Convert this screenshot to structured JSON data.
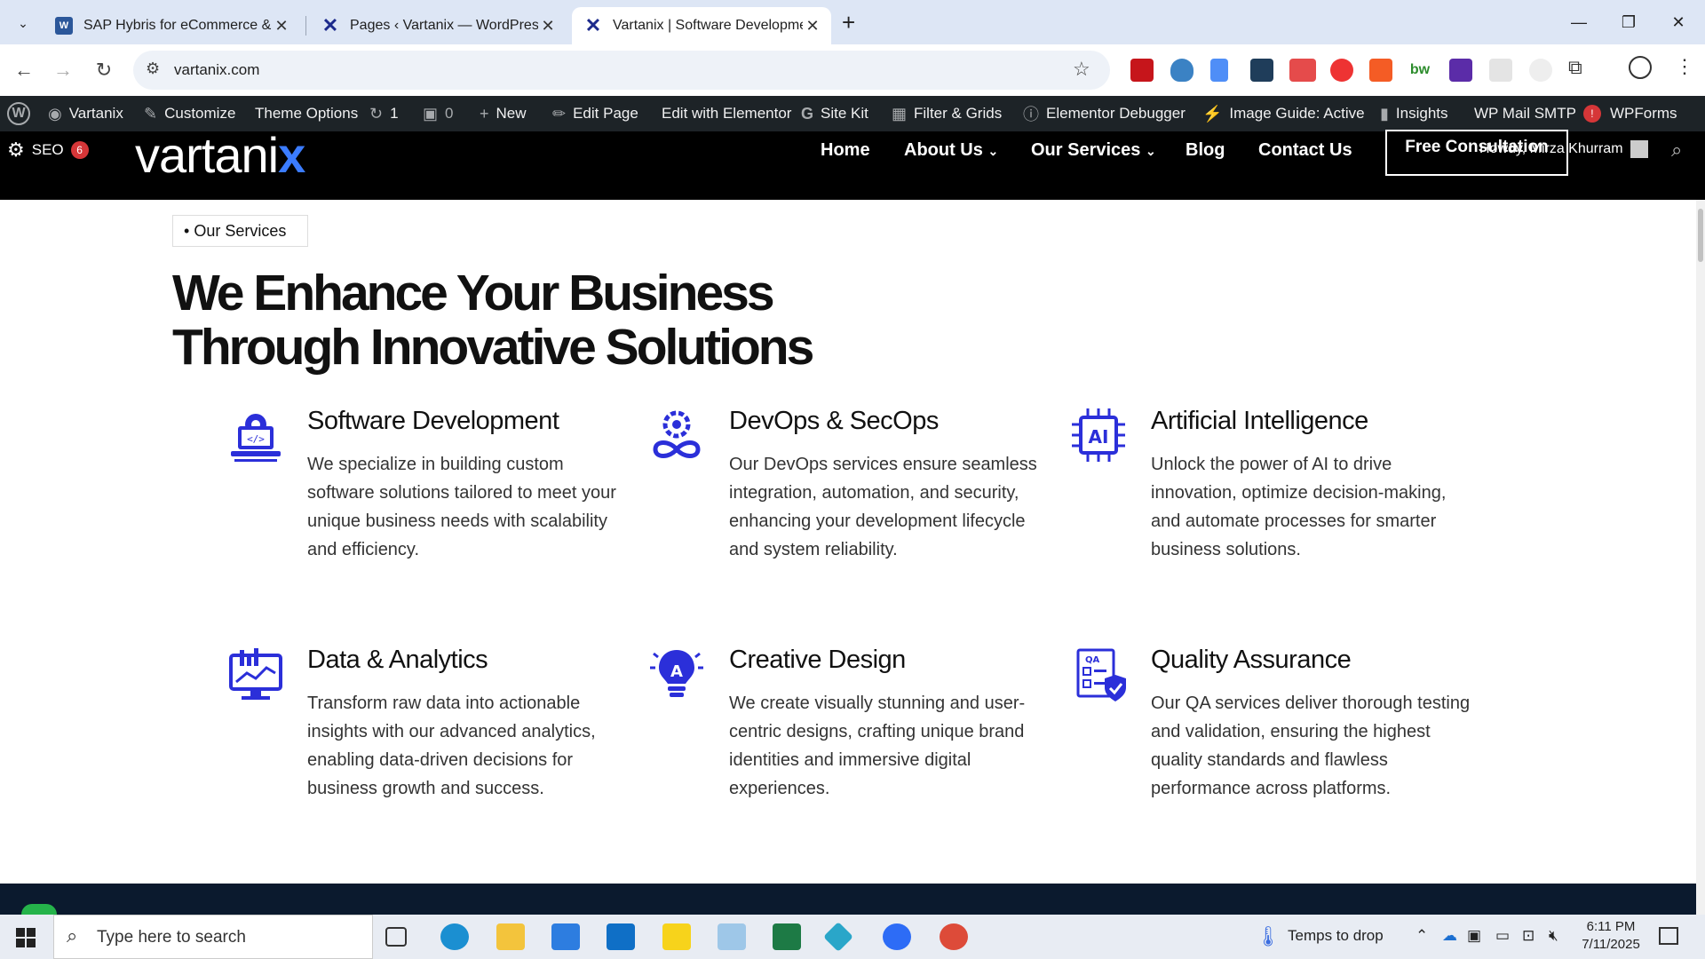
{
  "browser": {
    "tabs": [
      {
        "title": "SAP Hybris for eCommerce & D",
        "active": false
      },
      {
        "title": "Pages ‹ Vartanix — WordPress",
        "active": false
      },
      {
        "title": "Vartanix | Software Developmen",
        "active": true
      }
    ],
    "new_tab_label": "+",
    "url": "vartanix.com"
  },
  "wp_admin_bar": {
    "site_name": "Vartanix",
    "customize": "Customize",
    "theme_options": "Theme Options",
    "updates_count": "1",
    "comments_count": "0",
    "new": "New",
    "edit_page": "Edit Page",
    "edit_elementor": "Edit with Elementor",
    "site_kit": "Site Kit",
    "filter_grids": "Filter & Grids",
    "elementor_debugger": "Elementor Debugger",
    "image_guide": "Image Guide: Active",
    "insights": "Insights",
    "wp_mail_smtp": "WP Mail SMTP",
    "wp_mail_badge": "!",
    "wpforms": "WPForms",
    "seo": "SEO",
    "seo_badge": "6",
    "howdy": "Howdy, Mirza Khurram"
  },
  "site": {
    "logo_text": "vartani",
    "logo_x": "x",
    "nav": {
      "home": "Home",
      "about": "About Us",
      "services": "Our Services",
      "blog": "Blog",
      "contact": "Contact Us",
      "cta": "Free Consultation"
    }
  },
  "section": {
    "crumb": "Our Services",
    "headline_line1": "We Enhance Your Business",
    "headline_line2": "Through Innovative Solutions",
    "services": [
      {
        "title": "Software Development",
        "text": "We specialize in building custom software solutions tailored to meet your unique business needs with scalability and efficiency.",
        "icon": "laptop-code-icon"
      },
      {
        "title": "DevOps & SecOps",
        "text": "Our DevOps services ensure seamless integration, automation, and security, enhancing your development lifecycle and system reliability.",
        "icon": "devops-infinity-icon"
      },
      {
        "title": "Artificial Intelligence",
        "text": "Unlock the power of AI to drive innovation, optimize decision-making, and automate processes for smarter business solutions.",
        "icon": "ai-chip-icon"
      },
      {
        "title": "Data & Analytics",
        "text": "Transform raw data into actionable insights with our advanced analytics, enabling data-driven decisions for business growth and success.",
        "icon": "analytics-monitor-icon"
      },
      {
        "title": "Creative Design",
        "text": "We create visually stunning and user-centric designs, crafting unique brand identities and immersive digital experiences.",
        "icon": "lightbulb-icon"
      },
      {
        "title": "Quality Assurance",
        "text": "Our QA services deliver thorough testing and validation, ensuring the highest quality standards and flawless performance across platforms.",
        "icon": "qa-shield-icon"
      }
    ]
  },
  "taskbar": {
    "search_placeholder": "Type here to search",
    "weather": "Temps to drop",
    "time": "6:11 PM",
    "date": "7/11/2025"
  },
  "colors": {
    "accent": "#2b2fd9",
    "wpbar": "#1d2327",
    "header": "#000000"
  }
}
